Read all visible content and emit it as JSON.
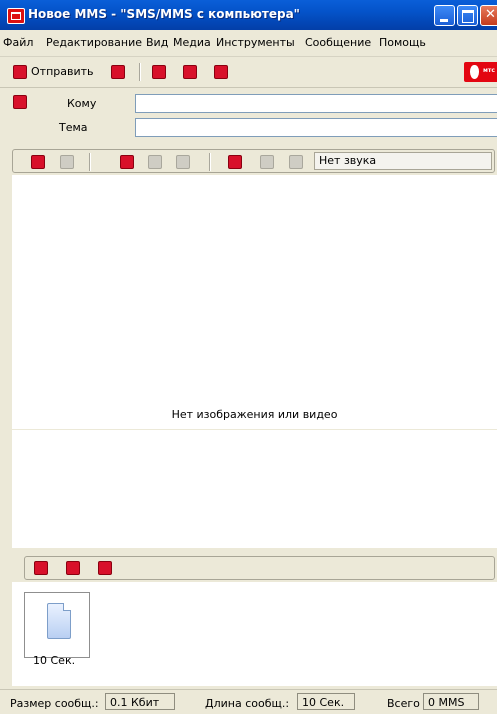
{
  "window": {
    "title": "Новое MMS - \"SMS/MMS с компьютера\"",
    "colors": {
      "titlebar": "#0453c9",
      "accent": "#d8102a",
      "chrome": "#ece9d8"
    }
  },
  "menu": {
    "items": [
      "Файл",
      "Редактирование",
      "Вид",
      "Медиа",
      "Инструменты",
      "Сообщение",
      "Помощь"
    ]
  },
  "toolbar": {
    "send_label": "Отправить",
    "icons": [
      "send-icon",
      "save-icon",
      "attach-icon",
      "envelope-icon",
      "settings-icon"
    ],
    "logo_text": "мтс"
  },
  "address": {
    "to_label": "Кому",
    "to_value": "",
    "subject_label": "Тема",
    "subject_value": ""
  },
  "slide_toolbar": {
    "sound_value": "Нет звука",
    "icons": [
      "insert-image-icon",
      "remove-image-icon",
      "insert-video-icon",
      "remove-video-icon",
      "video-icon",
      "insert-sound-icon",
      "remove-sound-icon",
      "sound-icon"
    ]
  },
  "media": {
    "placeholder": "Нет изображения или видео"
  },
  "slides_toolbar": {
    "icons": [
      "add-slide-icon",
      "delete-slide-icon",
      "slide-settings-icon"
    ]
  },
  "slides": [
    {
      "label": "10 Сек."
    }
  ],
  "status": {
    "size_label": "Размер сообщ.:",
    "size_value": "0.1 Кбит",
    "length_label": "Длина сообщ.:",
    "length_value": "10 Сек.",
    "total_label": "Всего",
    "total_value": "0 MMS"
  }
}
